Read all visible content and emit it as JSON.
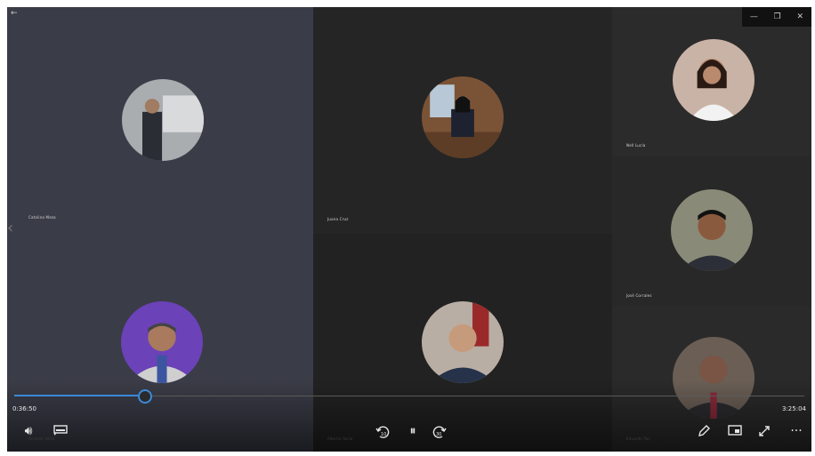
{
  "window": {
    "back_label": "←",
    "minimize_label": "—",
    "restore_label": "❐",
    "close_label": "✕"
  },
  "nav": {
    "prev_label": "‹"
  },
  "participants": [
    {
      "name": "Catalina Meza",
      "avatar_color": "#8a8f94"
    },
    {
      "name": "Juana Cruz",
      "avatar_color": "#8a6a50"
    },
    {
      "name": "Nell Lucía",
      "avatar_color": "#d8c4b8"
    },
    {
      "name": "José Corrales",
      "avatar_color": "#6e6a5c"
    },
    {
      "name": "Ricardo Vélez",
      "avatar_color": "#7a4fc0"
    },
    {
      "name": "Alberto Soria",
      "avatar_color": "#b0a59a"
    },
    {
      "name": "Eduardo Paz",
      "avatar_color": "#5a5048"
    }
  ],
  "player": {
    "elapsed": "0:36:50",
    "duration": "3:25:04",
    "progress": 0.164,
    "accent_color": "#3b8ad9",
    "icons": [
      "volume-icon",
      "captions-icon",
      "rewind-10-icon",
      "pause-icon",
      "forward-30-icon",
      "pen-icon",
      "miniplayer-icon",
      "fullscreen-icon",
      "more-icon"
    ],
    "labels": {
      "volume": "🔊︎",
      "pause": "⏸︎",
      "more": "···"
    }
  },
  "colors": {
    "tile_left": "#3a3c47",
    "tile_mid": "#252525",
    "tile_right": "#2b2b2b"
  }
}
